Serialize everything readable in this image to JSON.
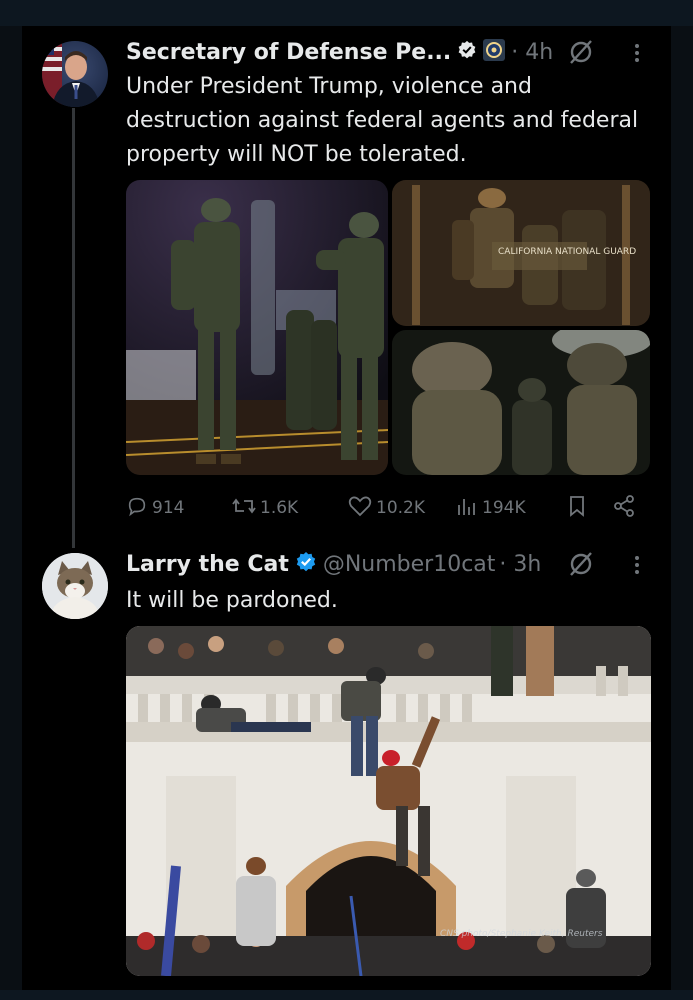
{
  "post1": {
    "author_name": "Secretary of Defense Pe...",
    "time": "· 4h",
    "text": "Under President Trump, violence and destruction against federal agents and federal property will NOT be tolerated.",
    "image_text": "CALIFORNIA NATIONAL GUARD",
    "stats": {
      "replies": "914",
      "reposts": "1.6K",
      "likes": "10.2K",
      "views": "194K"
    }
  },
  "post2": {
    "author_name": "Larry the Cat",
    "handle": "@Number10cat",
    "time": "· 3h",
    "text": "It will be pardoned.",
    "photo_credit": "CNS photo/Stephanie Keith, Reuters"
  },
  "icons": {
    "verified": "verified-badge-icon",
    "affiliation": "dod-seal-icon",
    "grok": "grok-icon",
    "more": "more-dots-icon",
    "reply": "reply-icon",
    "repost": "repost-icon",
    "like": "like-icon",
    "views": "views-icon",
    "bookmark": "bookmark-icon",
    "share": "share-icon"
  },
  "colors": {
    "background": "#000000",
    "text": "#e7e9ea",
    "muted": "#71767b",
    "verified": "#1d9bf0"
  }
}
